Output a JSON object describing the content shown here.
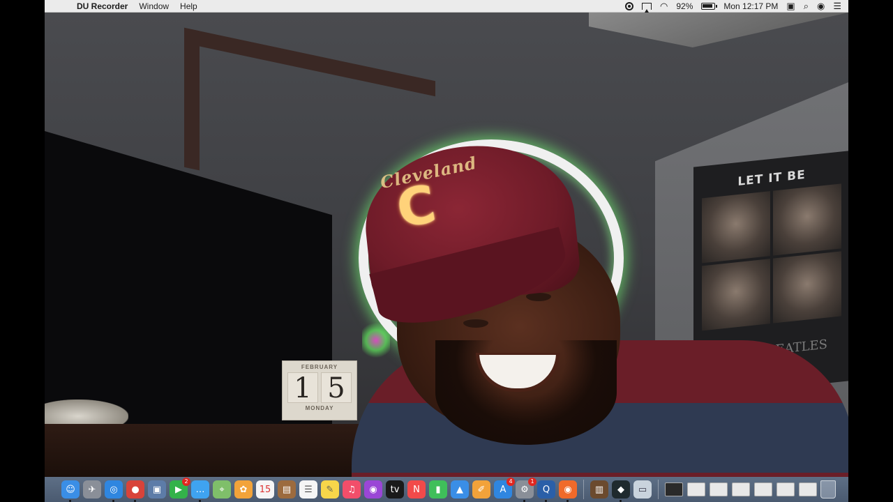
{
  "menubar": {
    "apple_glyph": "",
    "app_name": "DU Recorder",
    "menus": [
      "Window",
      "Help"
    ],
    "battery_percent": "92%",
    "clock": "Mon 12:17 PM",
    "icons": [
      "record-icon",
      "airplay-icon",
      "wifi-icon",
      "battery-icon",
      "display-icon",
      "search-icon",
      "siri-icon",
      "menu-list-icon"
    ]
  },
  "scene": {
    "cap_text": "Cleveland",
    "cap_logo": "C",
    "poster_title": "LET IT BE",
    "poster_band": "BEATLES",
    "calendar": {
      "month": "FEBRUARY",
      "day_tens": "1",
      "day_ones": "5",
      "weekday": "MONDAY"
    }
  },
  "dock": {
    "apps": [
      {
        "name": "finder-icon",
        "glyph": "☺",
        "color": "#3a8ee6",
        "running": true
      },
      {
        "name": "launchpad-icon",
        "glyph": "✈",
        "color": "#8a8f98",
        "running": false
      },
      {
        "name": "safari-icon",
        "glyph": "◎",
        "color": "#2f86e0",
        "running": true
      },
      {
        "name": "chrome-icon",
        "glyph": "●",
        "color": "#d8433a",
        "running": true
      },
      {
        "name": "preview-icon",
        "glyph": "▣",
        "color": "#5d7ca8",
        "running": false
      },
      {
        "name": "facetime-icon",
        "glyph": "▶",
        "color": "#33b24a",
        "badge": "2",
        "running": false
      },
      {
        "name": "messages-icon",
        "glyph": "…",
        "color": "#3fa3f0",
        "running": true
      },
      {
        "name": "maps-icon",
        "glyph": "⌖",
        "color": "#7fbf6a",
        "running": false
      },
      {
        "name": "photos-icon",
        "glyph": "✿",
        "color": "#f2a33a",
        "running": false
      },
      {
        "name": "calendar-icon",
        "glyph": "15",
        "color": "#f5f5f5",
        "text_color": "#d33",
        "running": false
      },
      {
        "name": "notes-book-icon",
        "glyph": "▤",
        "color": "#9c6b3e",
        "running": false
      },
      {
        "name": "reminders-icon",
        "glyph": "☰",
        "color": "#f5f5f5",
        "text_color": "#555",
        "running": false
      },
      {
        "name": "notes-icon",
        "glyph": "✎",
        "color": "#f7d64a",
        "text_color": "#665",
        "running": false
      },
      {
        "name": "music-icon",
        "glyph": "♫",
        "color": "#f24e6a",
        "running": false
      },
      {
        "name": "podcasts-icon",
        "glyph": "◉",
        "color": "#9a46d6",
        "running": false
      },
      {
        "name": "tv-icon",
        "glyph": "tv",
        "color": "#1a1a1a",
        "running": false
      },
      {
        "name": "news-icon",
        "glyph": "N",
        "color": "#f24a4a",
        "running": false
      },
      {
        "name": "numbers-icon",
        "glyph": "▮",
        "color": "#3fbf5a",
        "running": false
      },
      {
        "name": "keynote-icon",
        "glyph": "▲",
        "color": "#3a8ee6",
        "running": false
      },
      {
        "name": "pages-icon",
        "glyph": "✐",
        "color": "#f2a23a",
        "running": false
      },
      {
        "name": "app-store-icon",
        "glyph": "A",
        "color": "#2f86e0",
        "badge": "4",
        "running": false
      },
      {
        "name": "system-preferences-icon",
        "glyph": "⚙",
        "color": "#8a8f98",
        "badge": "1",
        "running": true
      },
      {
        "name": "quicktime-icon",
        "glyph": "Q",
        "color": "#2a5fa8",
        "running": true
      },
      {
        "name": "du-recorder-icon",
        "glyph": "◉",
        "color": "#f06a2a",
        "running": true
      }
    ],
    "extra_apps": [
      {
        "name": "notebook-icon",
        "glyph": "▥",
        "color": "#6b4a2e",
        "running": false
      },
      {
        "name": "editor-icon",
        "glyph": "◆",
        "color": "#1f2a2e",
        "running": true
      },
      {
        "name": "screenshot-tool-icon",
        "glyph": "▭",
        "color": "#c9d3dd",
        "text_color": "#334",
        "running": false
      }
    ],
    "thumbs": [
      {
        "name": "minimized-window-thumb",
        "dark": true
      },
      {
        "name": "minimized-window-thumb",
        "dark": false
      },
      {
        "name": "minimized-window-thumb",
        "dark": false
      },
      {
        "name": "minimized-window-thumb",
        "dark": false
      },
      {
        "name": "minimized-window-thumb",
        "dark": false
      },
      {
        "name": "minimized-window-thumb",
        "dark": false
      },
      {
        "name": "minimized-window-thumb",
        "dark": false
      }
    ]
  }
}
